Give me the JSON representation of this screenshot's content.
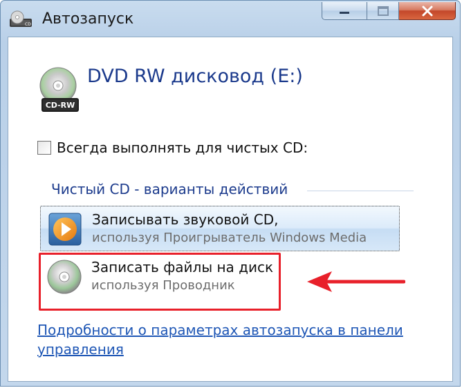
{
  "window": {
    "title": "Автозапуск",
    "app_icon": "cd-drive-icon"
  },
  "drive": {
    "title": "DVD RW дисковод (E:)",
    "badge": "CD-RW",
    "icon": "cd-rw-disc-icon"
  },
  "options": {
    "always_do_label": "Всегда выполнять для чистых CD:",
    "always_do_checked": false
  },
  "group": {
    "header": "Чистый CD - варианты действий"
  },
  "actions": [
    {
      "title": "Записывать звуковой CD,",
      "subtitle": "используя Проигрыватель Windows Media",
      "icon": "windows-media-player-icon",
      "selected": true
    },
    {
      "title": "Записать файлы на диск",
      "subtitle": "используя Проводник",
      "icon": "cd-disc-icon",
      "selected": false
    }
  ],
  "footer": {
    "help_link": "Подробности о параметрах автозапуска в панели управления"
  },
  "colors": {
    "title_blue": "#1b3a8c",
    "link_blue": "#1e56b5",
    "annotation_red": "#e8202a",
    "close_red": "#c3472a"
  }
}
